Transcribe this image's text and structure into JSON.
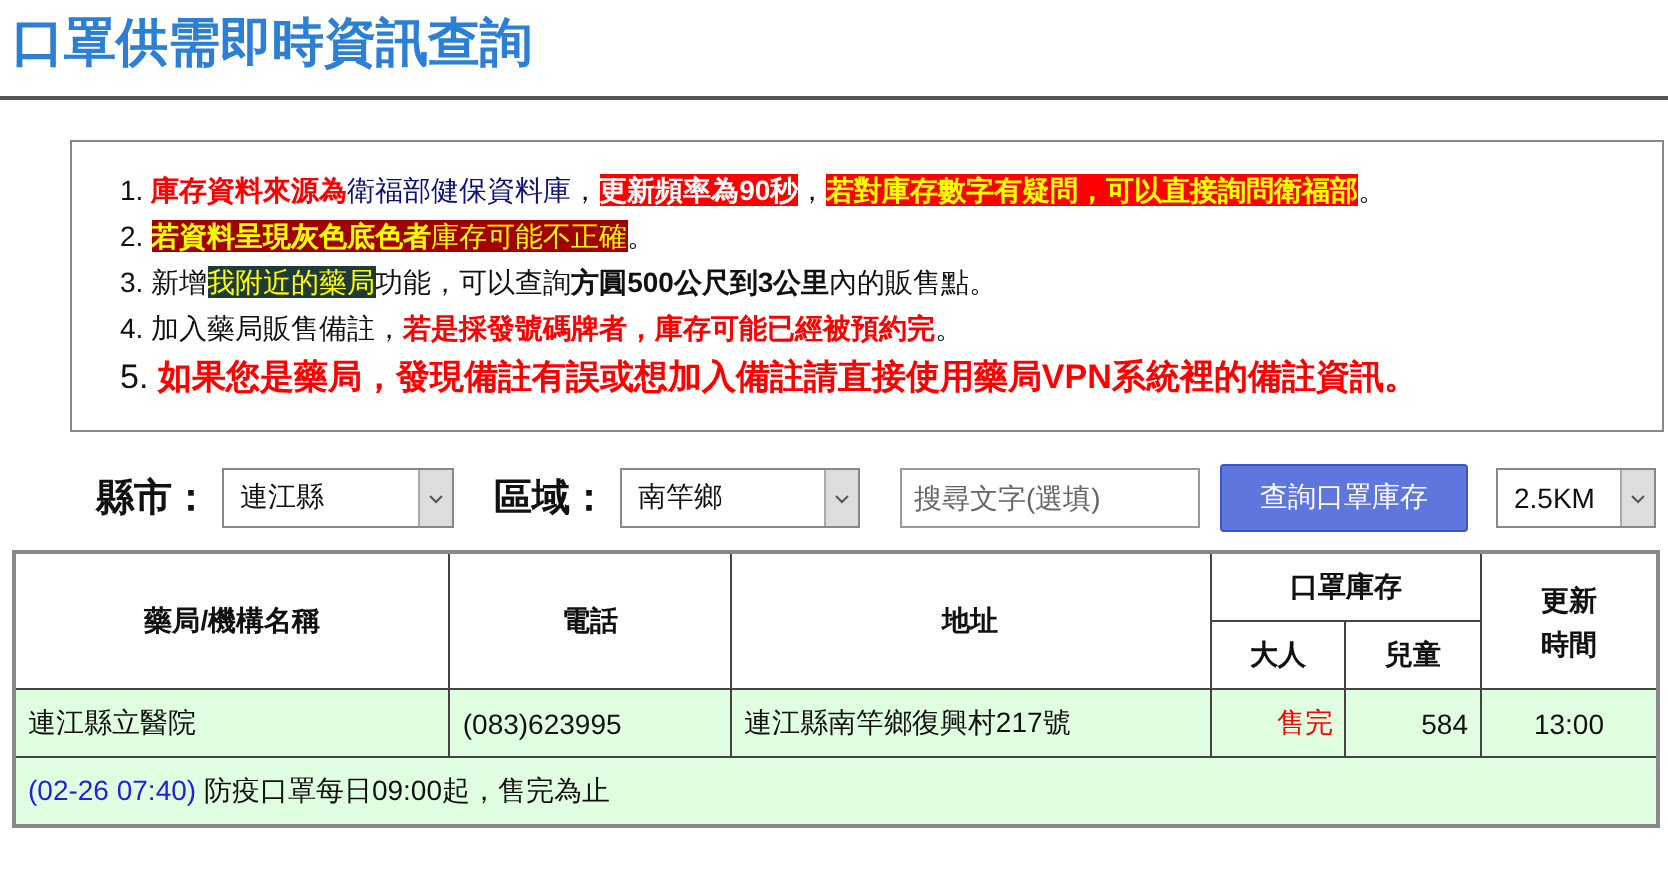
{
  "title": "口罩供需即時資訊查詢",
  "notices": [
    {
      "kind": "normal",
      "segments": [
        {
          "kind": "plain",
          "text": "1. "
        },
        {
          "kind": "red",
          "text": "庫存資料來源為"
        },
        {
          "kind": "navy",
          "text": "衛福部健保資料庫"
        },
        {
          "kind": "plain",
          "text": "，"
        },
        {
          "kind": "white-on-red",
          "text": "更新頻率為90秒"
        },
        {
          "kind": "plain",
          "text": "，"
        },
        {
          "kind": "yellow-on-red",
          "text": "若對庫存數字有疑問，可以直接詢問衛福部"
        },
        {
          "kind": "plain",
          "text": "。"
        }
      ]
    },
    {
      "kind": "normal",
      "segments": [
        {
          "kind": "plain",
          "text": "2. "
        },
        {
          "kind": "yellow-bold-on-maroon",
          "text": "若資料呈現灰色底色者"
        },
        {
          "kind": "yellow-on-maroon",
          "text": "庫存可能不正確"
        },
        {
          "kind": "plain",
          "text": "。"
        }
      ]
    },
    {
      "kind": "normal",
      "segments": [
        {
          "kind": "plain",
          "text": "3. 新增"
        },
        {
          "kind": "yellow-on-dark",
          "text": "我附近的藥局"
        },
        {
          "kind": "plain",
          "text": "功能，可以查詢"
        },
        {
          "kind": "bold",
          "text": "方圓500公尺到3公里"
        },
        {
          "kind": "plain",
          "text": "內的販售點。"
        }
      ]
    },
    {
      "kind": "normal",
      "segments": [
        {
          "kind": "plain",
          "text": "4. 加入藥局販售備註，"
        },
        {
          "kind": "red",
          "text": "若是採發號碼牌者，庫存可能已經被預約完"
        },
        {
          "kind": "plain",
          "text": "。"
        }
      ]
    },
    {
      "kind": "large",
      "segments": [
        {
          "kind": "plain",
          "text": "5. "
        },
        {
          "kind": "red",
          "text": "如果您是藥局，發現備註有誤或想加入備註請直接使用藥局VPN系統裡的備註資訊。"
        }
      ]
    }
  ],
  "filters": {
    "county_label": "縣市：",
    "county": "連江縣",
    "district_label": "區域：",
    "district": "南竿鄉",
    "search": {
      "placeholder": "搜尋文字(選填)"
    },
    "button": "查詢口罩庫存",
    "radius": "2.5KM"
  },
  "table": {
    "columns": {
      "name": "藥局/機構名稱",
      "phone": "電話",
      "address": "地址",
      "stock": "口罩庫存",
      "adult": "大人",
      "child": "兒童",
      "updated": "更新時間"
    },
    "rows": [
      {
        "name": "連江縣立醫院",
        "phone": "(083)623995",
        "address": "連江縣南竿鄉復興村217號",
        "adult": "售完",
        "adult_sold_out": true,
        "child": "584",
        "updated": "13:00",
        "note_time": "(02-26 07:40)",
        "note": "防疫口罩每日09:00起，售完為止"
      }
    ]
  }
}
